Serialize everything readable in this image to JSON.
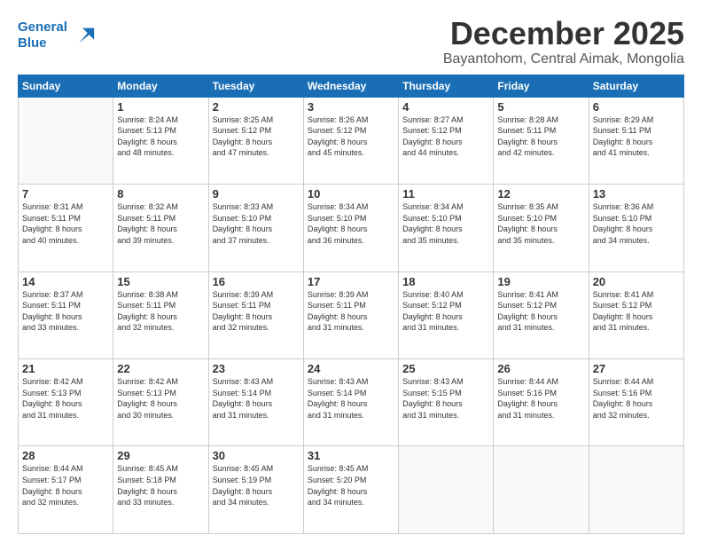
{
  "logo": {
    "line1": "General",
    "line2": "Blue"
  },
  "header": {
    "month": "December 2025",
    "location": "Bayantohom, Central Aimak, Mongolia"
  },
  "weekdays": [
    "Sunday",
    "Monday",
    "Tuesday",
    "Wednesday",
    "Thursday",
    "Friday",
    "Saturday"
  ],
  "weeks": [
    [
      {
        "day": "",
        "info": ""
      },
      {
        "day": "1",
        "info": "Sunrise: 8:24 AM\nSunset: 5:13 PM\nDaylight: 8 hours\nand 48 minutes."
      },
      {
        "day": "2",
        "info": "Sunrise: 8:25 AM\nSunset: 5:12 PM\nDaylight: 8 hours\nand 47 minutes."
      },
      {
        "day": "3",
        "info": "Sunrise: 8:26 AM\nSunset: 5:12 PM\nDaylight: 8 hours\nand 45 minutes."
      },
      {
        "day": "4",
        "info": "Sunrise: 8:27 AM\nSunset: 5:12 PM\nDaylight: 8 hours\nand 44 minutes."
      },
      {
        "day": "5",
        "info": "Sunrise: 8:28 AM\nSunset: 5:11 PM\nDaylight: 8 hours\nand 42 minutes."
      },
      {
        "day": "6",
        "info": "Sunrise: 8:29 AM\nSunset: 5:11 PM\nDaylight: 8 hours\nand 41 minutes."
      }
    ],
    [
      {
        "day": "7",
        "info": "Sunrise: 8:31 AM\nSunset: 5:11 PM\nDaylight: 8 hours\nand 40 minutes."
      },
      {
        "day": "8",
        "info": "Sunrise: 8:32 AM\nSunset: 5:11 PM\nDaylight: 8 hours\nand 39 minutes."
      },
      {
        "day": "9",
        "info": "Sunrise: 8:33 AM\nSunset: 5:10 PM\nDaylight: 8 hours\nand 37 minutes."
      },
      {
        "day": "10",
        "info": "Sunrise: 8:34 AM\nSunset: 5:10 PM\nDaylight: 8 hours\nand 36 minutes."
      },
      {
        "day": "11",
        "info": "Sunrise: 8:34 AM\nSunset: 5:10 PM\nDaylight: 8 hours\nand 35 minutes."
      },
      {
        "day": "12",
        "info": "Sunrise: 8:35 AM\nSunset: 5:10 PM\nDaylight: 8 hours\nand 35 minutes."
      },
      {
        "day": "13",
        "info": "Sunrise: 8:36 AM\nSunset: 5:10 PM\nDaylight: 8 hours\nand 34 minutes."
      }
    ],
    [
      {
        "day": "14",
        "info": "Sunrise: 8:37 AM\nSunset: 5:11 PM\nDaylight: 8 hours\nand 33 minutes."
      },
      {
        "day": "15",
        "info": "Sunrise: 8:38 AM\nSunset: 5:11 PM\nDaylight: 8 hours\nand 32 minutes."
      },
      {
        "day": "16",
        "info": "Sunrise: 8:39 AM\nSunset: 5:11 PM\nDaylight: 8 hours\nand 32 minutes."
      },
      {
        "day": "17",
        "info": "Sunrise: 8:39 AM\nSunset: 5:11 PM\nDaylight: 8 hours\nand 31 minutes."
      },
      {
        "day": "18",
        "info": "Sunrise: 8:40 AM\nSunset: 5:12 PM\nDaylight: 8 hours\nand 31 minutes."
      },
      {
        "day": "19",
        "info": "Sunrise: 8:41 AM\nSunset: 5:12 PM\nDaylight: 8 hours\nand 31 minutes."
      },
      {
        "day": "20",
        "info": "Sunrise: 8:41 AM\nSunset: 5:12 PM\nDaylight: 8 hours\nand 31 minutes."
      }
    ],
    [
      {
        "day": "21",
        "info": "Sunrise: 8:42 AM\nSunset: 5:13 PM\nDaylight: 8 hours\nand 31 minutes."
      },
      {
        "day": "22",
        "info": "Sunrise: 8:42 AM\nSunset: 5:13 PM\nDaylight: 8 hours\nand 30 minutes."
      },
      {
        "day": "23",
        "info": "Sunrise: 8:43 AM\nSunset: 5:14 PM\nDaylight: 8 hours\nand 31 minutes."
      },
      {
        "day": "24",
        "info": "Sunrise: 8:43 AM\nSunset: 5:14 PM\nDaylight: 8 hours\nand 31 minutes."
      },
      {
        "day": "25",
        "info": "Sunrise: 8:43 AM\nSunset: 5:15 PM\nDaylight: 8 hours\nand 31 minutes."
      },
      {
        "day": "26",
        "info": "Sunrise: 8:44 AM\nSunset: 5:16 PM\nDaylight: 8 hours\nand 31 minutes."
      },
      {
        "day": "27",
        "info": "Sunrise: 8:44 AM\nSunset: 5:16 PM\nDaylight: 8 hours\nand 32 minutes."
      }
    ],
    [
      {
        "day": "28",
        "info": "Sunrise: 8:44 AM\nSunset: 5:17 PM\nDaylight: 8 hours\nand 32 minutes."
      },
      {
        "day": "29",
        "info": "Sunrise: 8:45 AM\nSunset: 5:18 PM\nDaylight: 8 hours\nand 33 minutes."
      },
      {
        "day": "30",
        "info": "Sunrise: 8:45 AM\nSunset: 5:19 PM\nDaylight: 8 hours\nand 34 minutes."
      },
      {
        "day": "31",
        "info": "Sunrise: 8:45 AM\nSunset: 5:20 PM\nDaylight: 8 hours\nand 34 minutes."
      },
      {
        "day": "",
        "info": ""
      },
      {
        "day": "",
        "info": ""
      },
      {
        "day": "",
        "info": ""
      }
    ]
  ]
}
